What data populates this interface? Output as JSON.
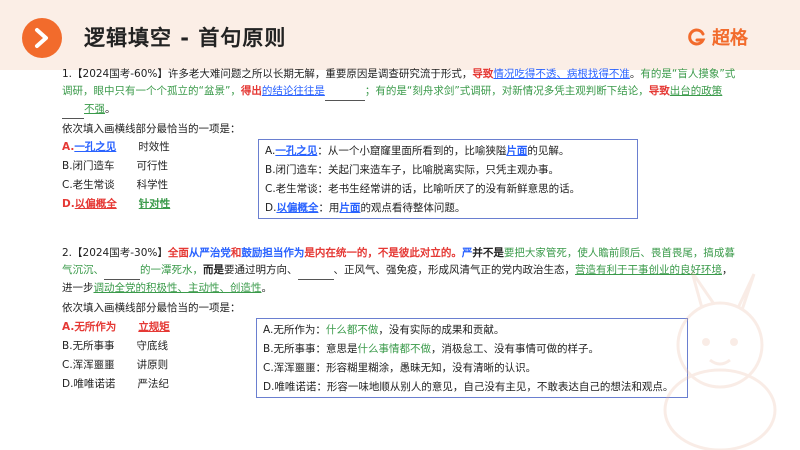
{
  "header": {
    "title": "逻辑填空 - 首句原则",
    "brand": "超格",
    "accent": "#f26b2c"
  },
  "q1": {
    "num": "1.【2024国考-60%】",
    "t1": "许多老大难问题之所以长期无解，重要原因是调查研究流于形式，",
    "t2": "导致",
    "t3": "情况吃得不透、病根找得不准",
    "t4": "。",
    "t5": "有的是“盲人摸象”式调研，眼中只有一个个孤立的“盆景”，",
    "t6": "得出",
    "t7": "的结论往往是",
    "t8": "；有的是“刻舟求剑”式调研，对新情况多凭主观判断下结论，",
    "t9": "导致",
    "t10": "出台的政策",
    "t11": "不强",
    "t12": "。",
    "prompt": "依次填入画横线部分最恰当的一项是：",
    "options": [
      {
        "letter": "A.",
        "w1": "一孔之见",
        "w2": "时效性"
      },
      {
        "letter": "B.",
        "w1": "闭门造车",
        "w2": "可行性"
      },
      {
        "letter": "C.",
        "w1": "老生常谈",
        "w2": "科学性"
      },
      {
        "letter": "D.",
        "w1": "以偏概全",
        "w2": "针对性"
      }
    ],
    "defs": [
      {
        "a": "A.",
        "b": "一孔之见",
        "c": "：从一个小窟窿里面所看到的，比喻狭隘",
        "d": "片面",
        "e": "的见解。"
      },
      {
        "a": "B.",
        "b": "闭门造车",
        "c": "：关起门来造车子，比喻脱离实际，只凭主观办事。",
        "d": "",
        "e": ""
      },
      {
        "a": "C.",
        "b": "老生常谈",
        "c": "：老书生经常讲的话，比喻听厌了的没有新鲜意思的话。",
        "d": "",
        "e": ""
      },
      {
        "a": "D.",
        "b": "以偏概全",
        "c": "：用",
        "d": "片面",
        "e": "的观点看待整体问题。"
      }
    ]
  },
  "q2": {
    "num": "2.【2024国考-30%】",
    "t1": "全面",
    "t2": "从严治党",
    "t3": "和",
    "t4": "鼓励担当作为",
    "t5": "是内在统一的，不是彼此对立的。",
    "t6": "严",
    "t7": "并不是",
    "t8": "要把大家管死，使人瞻前顾后、畏首畏尾，搞成暮气沉沉、",
    "t9": "的一潭死水，",
    "t10": "而是",
    "t11": "要通过明方向、",
    "t12": "、正风气、强免疫，形成风清气正的党内政治生态，",
    "t13": "营造有利于干事创业的良好环境",
    "t14": "，进一步",
    "t15": "调动全党的积极性、主动性、创造性",
    "t16": "。",
    "prompt": "依次填入画横线部分最恰当的一项是：",
    "options": [
      {
        "letter": "A.",
        "w1": "无所作为",
        "w2": "立规矩"
      },
      {
        "letter": "B.",
        "w1": "无所事事",
        "w2": "守底线"
      },
      {
        "letter": "C.",
        "w1": "浑浑噩噩",
        "w2": "讲原则"
      },
      {
        "letter": "D.",
        "w1": "唯唯诺诺",
        "w2": "严法纪"
      }
    ],
    "defs": [
      {
        "a": "A.",
        "b": "无所作为",
        "c": "：",
        "d": "什么都不做",
        "e": "，没有实际的成果和贡献。"
      },
      {
        "a": "B.",
        "b": "无所事事",
        "c": "：意思是",
        "d": "什么事情都不做",
        "e": "，消极怠工、没有事情可做的样子。"
      },
      {
        "a": "C.",
        "b": "浑浑噩噩",
        "c": "：形容糊里糊涂，愚昧无知，没有清晰的认识。",
        "d": "",
        "e": ""
      },
      {
        "a": "D.",
        "b": "唯唯诺诺",
        "c": "：形容一味地顺从别人的意见，自己没有主见，不敢表达自己的想法和观点。",
        "d": "",
        "e": ""
      }
    ]
  }
}
